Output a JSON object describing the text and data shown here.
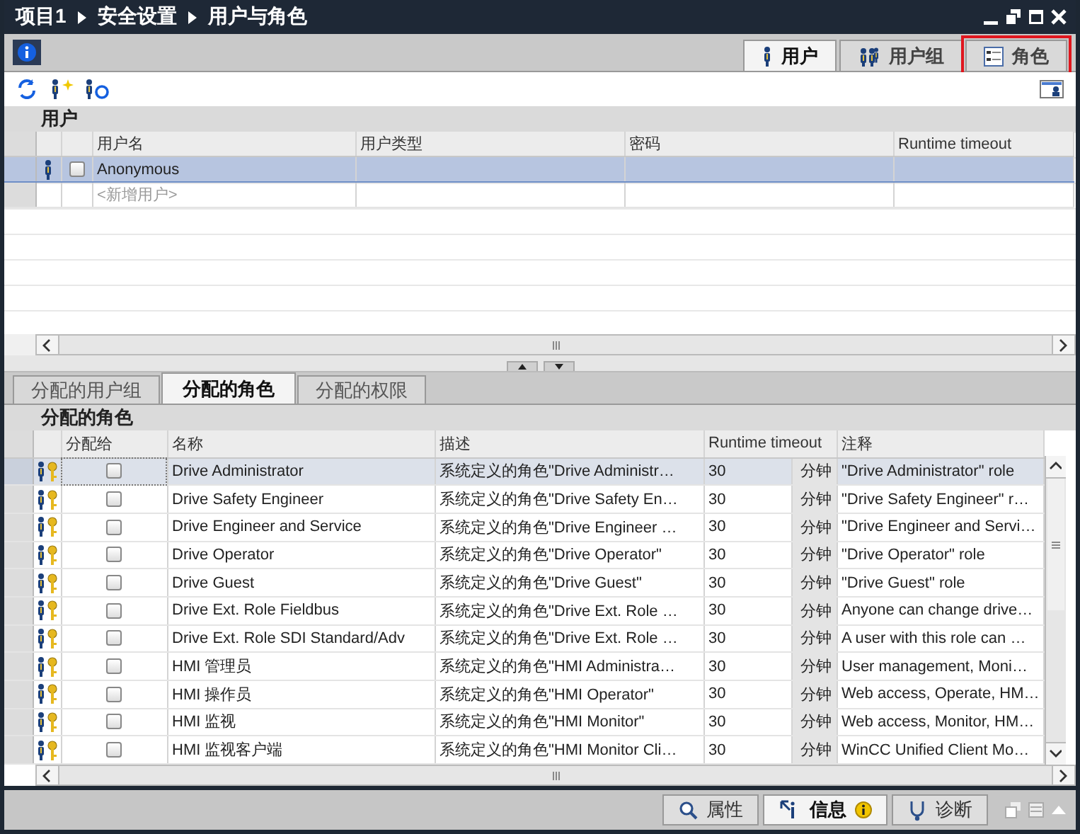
{
  "window": {
    "breadcrumb": [
      "项目1",
      "安全设置",
      "用户与角色"
    ]
  },
  "tabs": [
    {
      "label": "用户",
      "kind": "user",
      "selected": true,
      "highlighted": false
    },
    {
      "label": "用户组",
      "kind": "group",
      "selected": false,
      "highlighted": false
    },
    {
      "label": "角色",
      "kind": "list",
      "selected": false,
      "highlighted": true
    }
  ],
  "users": {
    "title": "用户",
    "columns": [
      "用户名",
      "用户类型",
      "密码",
      "Runtime timeout"
    ],
    "rows": [
      {
        "name": "Anonymous",
        "checked": false,
        "selected": true
      }
    ],
    "new_row": "<新增用户>"
  },
  "detail_tabs": [
    {
      "label": "分配的用户组",
      "selected": false
    },
    {
      "label": "分配的角色",
      "selected": true
    },
    {
      "label": "分配的权限",
      "selected": false
    }
  ],
  "roles": {
    "title": "分配的角色",
    "columns": [
      "分配给",
      "名称",
      "描述",
      "Runtime timeout",
      "注释"
    ],
    "rows": [
      {
        "name": "Drive Administrator",
        "description": "系统定义的角色\"Drive Administr…",
        "timeout": "30",
        "unit": "分钟",
        "comment": "\"Drive Administrator\" role",
        "checked": false,
        "selected": true
      },
      {
        "name": "Drive Safety Engineer",
        "description": "系统定义的角色\"Drive Safety En…",
        "timeout": "30",
        "unit": "分钟",
        "comment": "\"Drive Safety Engineer\" r…",
        "checked": false,
        "selected": false
      },
      {
        "name": "Drive Engineer and Service",
        "description": "系统定义的角色\"Drive Engineer …",
        "timeout": "30",
        "unit": "分钟",
        "comment": "\"Drive Engineer and Servi…",
        "checked": false,
        "selected": false
      },
      {
        "name": "Drive Operator",
        "description": "系统定义的角色\"Drive Operator\"",
        "timeout": "30",
        "unit": "分钟",
        "comment": "\"Drive Operator\" role",
        "checked": false,
        "selected": false
      },
      {
        "name": "Drive Guest",
        "description": "系统定义的角色\"Drive Guest\"",
        "timeout": "30",
        "unit": "分钟",
        "comment": "\"Drive Guest\" role",
        "checked": false,
        "selected": false
      },
      {
        "name": "Drive Ext. Role Fieldbus",
        "description": "系统定义的角色\"Drive Ext. Role …",
        "timeout": "30",
        "unit": "分钟",
        "comment": "Anyone can change drive…",
        "checked": false,
        "selected": false
      },
      {
        "name": "Drive Ext. Role SDI Standard/Adv",
        "description": "系统定义的角色\"Drive Ext. Role …",
        "timeout": "30",
        "unit": "分钟",
        "comment": "A user with this role can …",
        "checked": false,
        "selected": false
      },
      {
        "name": "HMI 管理员",
        "description": "系统定义的角色\"HMI Administra…",
        "timeout": "30",
        "unit": "分钟",
        "comment": "User management, Moni…",
        "checked": false,
        "selected": false
      },
      {
        "name": "HMI 操作员",
        "description": "系统定义的角色\"HMI Operator\"",
        "timeout": "30",
        "unit": "分钟",
        "comment": "Web access, Operate, HM…",
        "checked": false,
        "selected": false
      },
      {
        "name": "HMI 监视",
        "description": "系统定义的角色\"HMI Monitor\"",
        "timeout": "30",
        "unit": "分钟",
        "comment": "Web access, Monitor, HM…",
        "checked": false,
        "selected": false
      },
      {
        "name": "HMI 监视客户端",
        "description": "系统定义的角色\"HMI Monitor Cli…",
        "timeout": "30",
        "unit": "分钟",
        "comment": "WinCC Unified Client Mo…",
        "checked": false,
        "selected": false
      }
    ]
  },
  "status_tabs": [
    {
      "label": "属性",
      "kind": "search",
      "selected": false,
      "badge": false
    },
    {
      "label": "信息",
      "kind": "info",
      "selected": true,
      "badge": true
    },
    {
      "label": "诊断",
      "kind": "diag",
      "selected": false,
      "badge": false
    }
  ]
}
